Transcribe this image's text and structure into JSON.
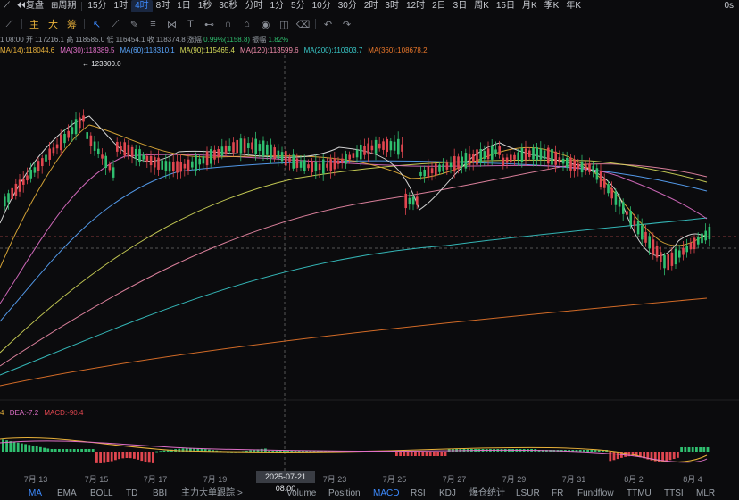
{
  "topbar": {
    "items": [
      "1秒",
      "复盘",
      "周期",
      "15分",
      "1时",
      "4时",
      "8时",
      "1日",
      "1秒",
      "30秒",
      "分时",
      "1分",
      "5分",
      "10分",
      "30分",
      "2时",
      "3时",
      "12时",
      "2日",
      "3日",
      "周K",
      "15日",
      "月K",
      "季K",
      "年K"
    ],
    "active_index": 5,
    "right_label": "0s"
  },
  "toolbar": {
    "labels": [
      "主",
      "大",
      "筹"
    ]
  },
  "info": {
    "time": "1 08:00",
    "open_label": "开",
    "open": "117216.1",
    "high_label": "高",
    "high": "118585.0",
    "low_label": "低",
    "low": "116454.1",
    "close_label": "收",
    "close": "118374.8",
    "change_label": "涨幅",
    "change": "0.99%(1158.8)",
    "amp_label": "振幅",
    "amp": "1.82%"
  },
  "ma_legend": [
    {
      "label": "MA(14):118044.6",
      "color": "#e8b13a"
    },
    {
      "label": "MA(30):118389.5",
      "color": "#e070c8"
    },
    {
      "label": "MA(60):118310.1",
      "color": "#5aa7ff"
    },
    {
      "label": "MA(90):115465.4",
      "color": "#d6dc5a"
    },
    {
      "label": "MA(120):113599.6",
      "color": "#f08caa"
    },
    {
      "label": "MA(200):110303.7",
      "color": "#39c9c9"
    },
    {
      "label": "MA(360):108678.2",
      "color": "#e8762a"
    }
  ],
  "price": {
    "high_marker": "123300.0"
  },
  "macd_legend": {
    "dif": "4",
    "dea_label": "DEA:",
    "dea": "-7.2",
    "macd_label": "MACD:",
    "macd": "-90.4"
  },
  "x_axis": {
    "labels": [
      "7月 13",
      "7月 15",
      "7月 17",
      "7月 19",
      "7月 23",
      "7月 25",
      "7月 27",
      "7月 29",
      "7月 31",
      "8月 2",
      "8月 4"
    ],
    "cursor_date": "2025-07-21 08:00"
  },
  "bottom_tabs": {
    "items": [
      "MA",
      "EMA",
      "BOLL",
      "TD",
      "BBI",
      "主力大单跟踪",
      ">",
      "Volume",
      "Position",
      "MACD",
      "RSI",
      "KDJ",
      "爆仓统计",
      "LSUR",
      "FR",
      "Fundflow",
      "TTMU",
      "TTSI",
      "MLR"
    ],
    "active": [
      "MA",
      "MACD"
    ]
  },
  "colors": {
    "up": "#2fbf6f",
    "down": "#e0464f",
    "accent": "#3d8bff",
    "toolbar_cn": "#e8b13a"
  }
}
